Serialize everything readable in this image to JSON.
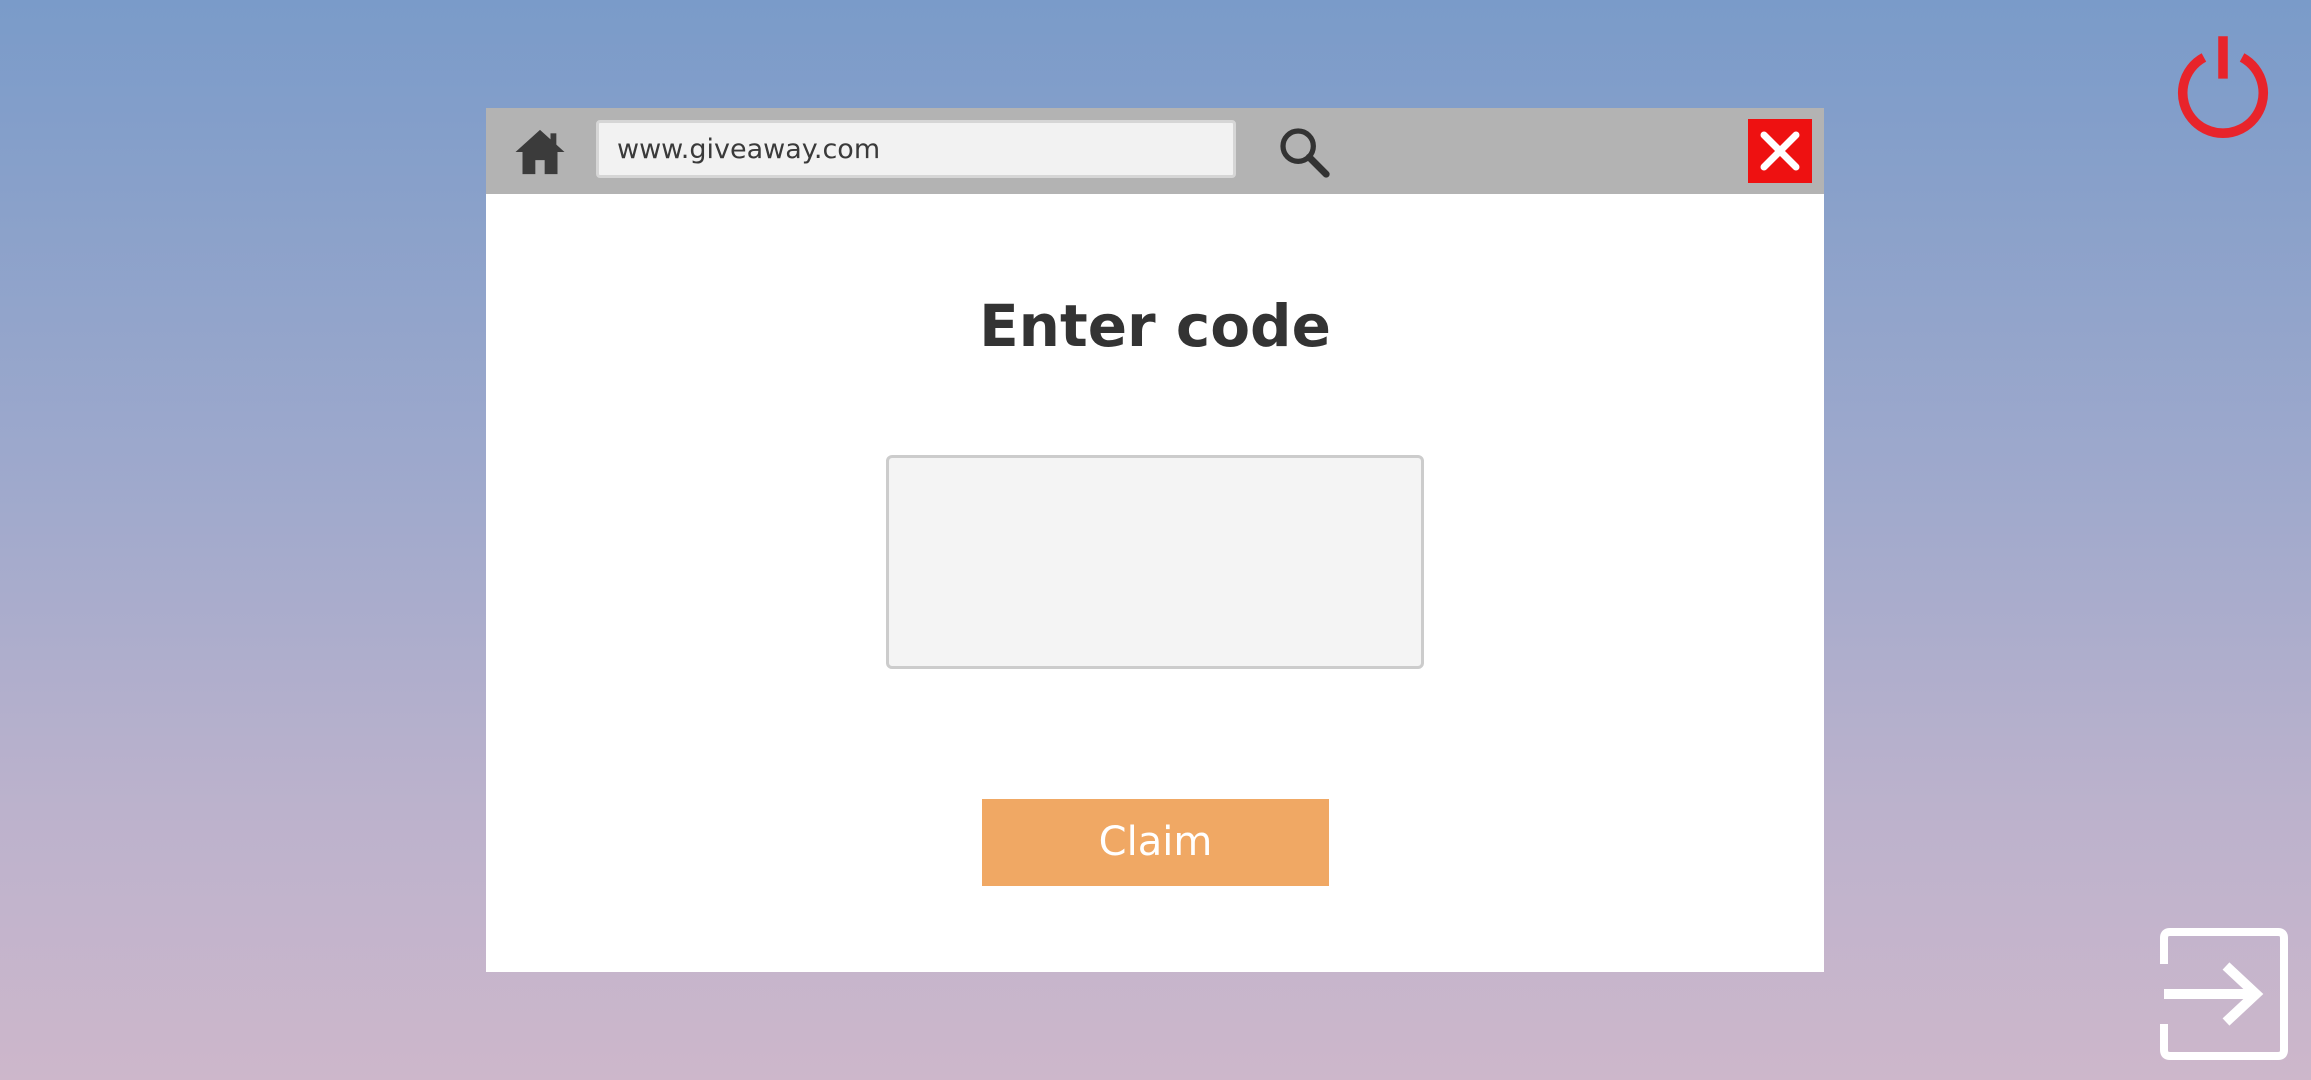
{
  "colors": {
    "power_icon": "#e8242b",
    "toolbar": "#b3b3b3",
    "close_button": "#ee1111",
    "claim_button": "#f0a864",
    "exit_icon": "#ffffff"
  },
  "icons": {
    "power": "power-icon",
    "home": "home-icon",
    "search": "search-icon",
    "close": "close-icon",
    "exit": "exit-icon"
  },
  "browser": {
    "url": "www.giveaway.com"
  },
  "page": {
    "title": "Enter code",
    "code_input_value": "",
    "claim_label": "Claim"
  }
}
